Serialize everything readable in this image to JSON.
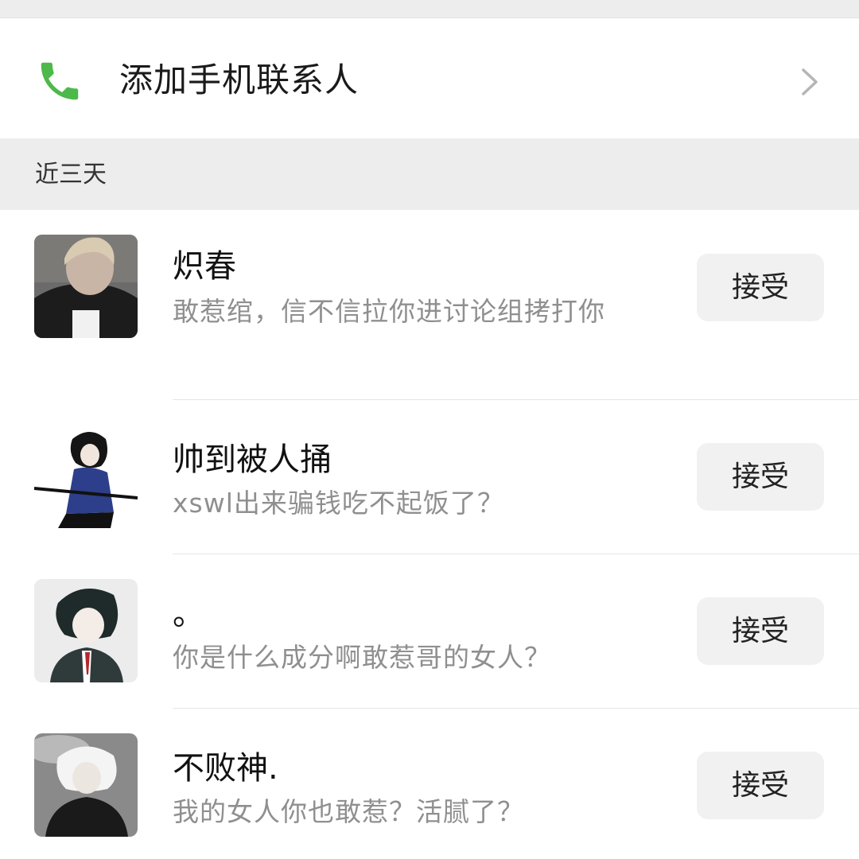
{
  "add_contact": {
    "label": "添加手机联系人",
    "icon": "phone-icon",
    "accent": "#4cb94a"
  },
  "section": {
    "label": "近三天"
  },
  "requests": [
    {
      "name": "炽春",
      "message": "敢惹绾，信不信拉你进讨论组拷打你",
      "button": "接受",
      "avatar": "avatar-person-photo"
    },
    {
      "name": "帅到被人捅",
      "message": "xswl出来骗钱吃不起饭了？",
      "button": "接受",
      "avatar": "avatar-anime-swordsman"
    },
    {
      "name": "。",
      "message": "你是什么成分啊敢惹哥的女人？",
      "button": "接受",
      "avatar": "avatar-anime-dark-hair"
    },
    {
      "name": "不败神.",
      "message": "我的女人你也敢惹？活腻了？",
      "button": "接受",
      "avatar": "avatar-anime-white-hair"
    }
  ]
}
